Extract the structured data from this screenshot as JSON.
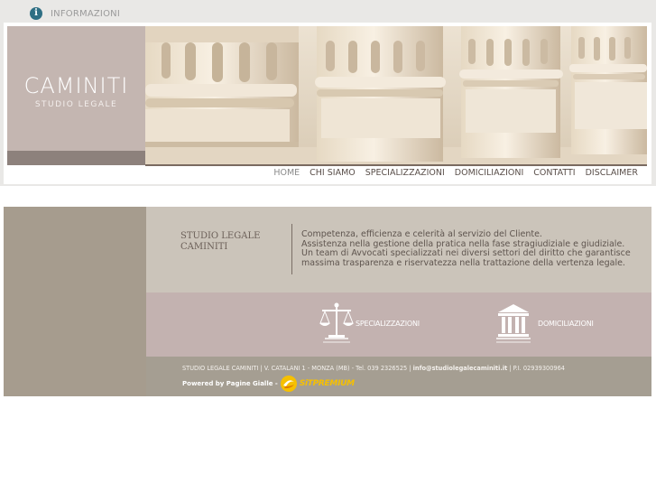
{
  "topbar": {
    "info_label": "INFORMAZIONI",
    "icon": "info-icon"
  },
  "logo": {
    "name": "CAMINITI",
    "subtitle": "STUDIO LEGALE"
  },
  "nav": {
    "items": [
      "HOME",
      "CHI SIAMO",
      "SPECIALIZZAZIONI",
      "DOMICILIAZIONI",
      "CONTATTI",
      "DISCLAIMER"
    ],
    "active": "HOME"
  },
  "intro": {
    "title_line1": "STUDIO LEGALE",
    "title_line2": "CAMINITI",
    "lines": [
      "Competenza, efficienza e celerità al servizio del Cliente.",
      "Assistenza nella gestione della pratica nella fase stragiudiziale e giudiziale.",
      "Un team di Avvocati specializzati nei diversi settori del diritto che garantisce",
      "massima trasparenza e riservatezza nella trattazione della vertenza legale."
    ]
  },
  "links": {
    "specializzazioni": "SPECIALIZZAZIONI",
    "domiciliazioni": "DOMICILIAZIONI"
  },
  "footer": {
    "address": "STUDIO LEGALE CAMINITI | V. CATALANI 1 - MONZA (MB) - Tel. 039 2326525 | ",
    "email": "info@studiolegalecaminiti.it",
    "vat": " | P.I. 02939300964",
    "powered": "Powered by Pagine Gialle -",
    "badge": "SiTPREMIUM"
  },
  "colors": {
    "logo_panel": "#c4b6b1",
    "main_bg": "#cbc4ba",
    "left_column": "#a69c8e",
    "icon_band": "#c3b2b0",
    "footer_bg": "#a59e92",
    "badge": "#f6c000"
  }
}
